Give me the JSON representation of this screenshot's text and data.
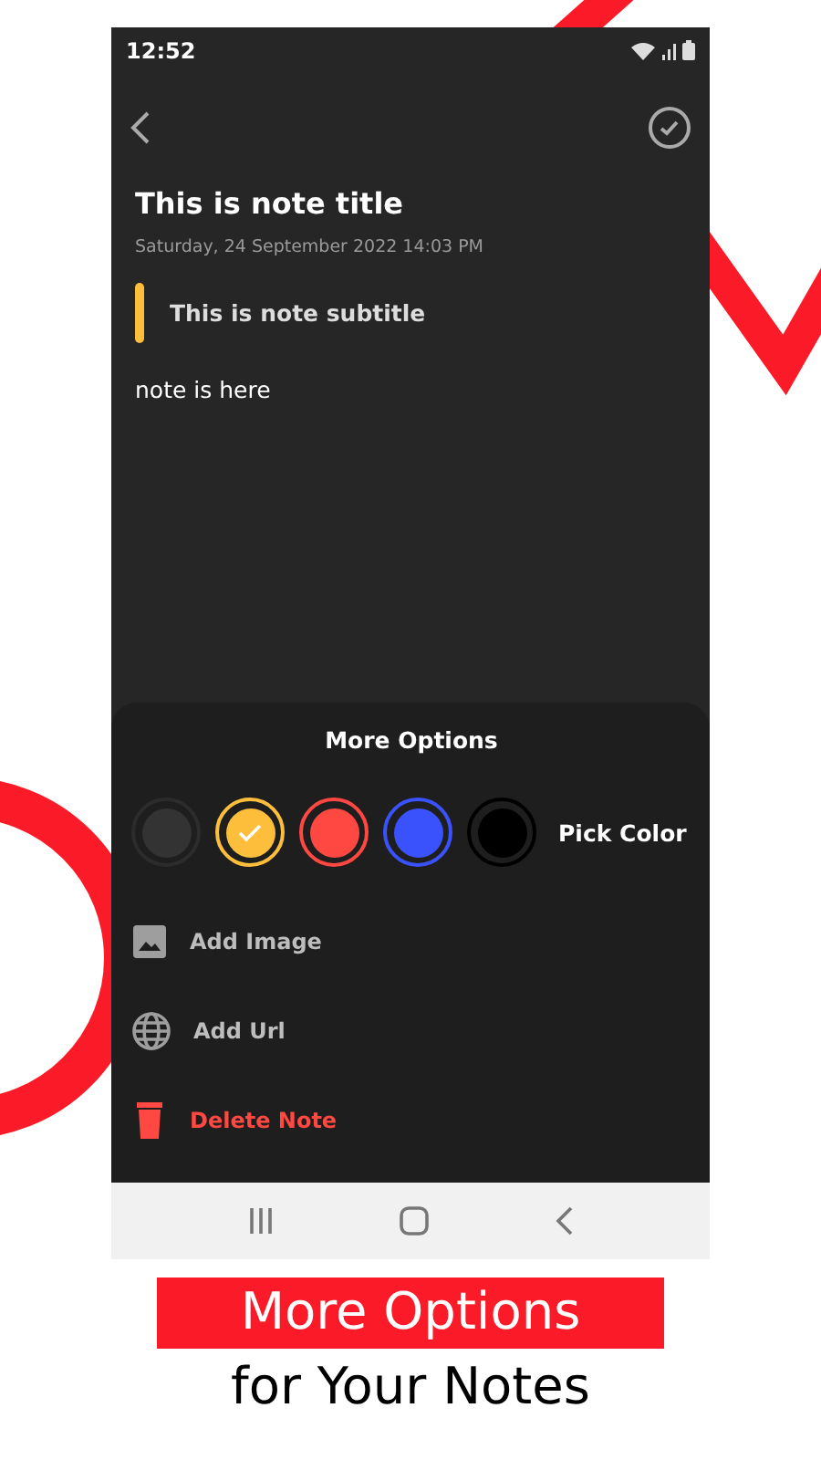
{
  "status_bar": {
    "time": "12:52"
  },
  "note": {
    "title": "This is note title",
    "datetime": "Saturday, 24 September 2022 14:03 PM",
    "subtitle": "This is note subtitle",
    "body": "note is here"
  },
  "options": {
    "title": "More Options",
    "colors": [
      {
        "color": "#333333",
        "selected": false
      },
      {
        "color": "#fdbe3b",
        "selected": true
      },
      {
        "color": "#ff4842",
        "selected": false
      },
      {
        "color": "#3a52fc",
        "selected": false
      },
      {
        "color": "#000000",
        "selected": false
      }
    ],
    "pick_label": "Pick Color",
    "actions": [
      {
        "kind": "image",
        "label": "Add Image"
      },
      {
        "kind": "url",
        "label": "Add Url"
      },
      {
        "kind": "delete",
        "label": "Delete Note"
      }
    ]
  },
  "banner": {
    "headline": "More Options",
    "tagline": "for Your Notes"
  }
}
